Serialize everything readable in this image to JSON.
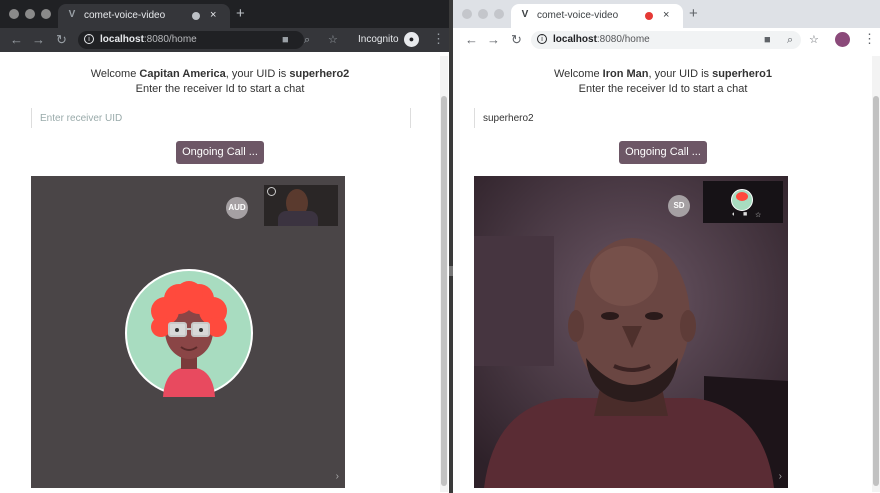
{
  "left_window": {
    "tab_title": "comet-voice-video",
    "url_host": "localhost",
    "url_path": ":8080/home",
    "incognito_label": "Incognito",
    "welcome_prefix": "Welcome ",
    "user_name": "Capitan America",
    "uid_text": ", your UID is ",
    "uid": "superhero2",
    "instructions": "Enter the receiver Id to start a chat",
    "receiver_placeholder": "Enter receiver UID",
    "receiver_value": "",
    "call_button": "Ongoing Call ...",
    "caller_badge": "AUD"
  },
  "right_window": {
    "tab_title": "comet-voice-video",
    "url_host": "localhost",
    "url_path": ":8080/home",
    "welcome_prefix": "Welcome ",
    "user_name": "Iron Man",
    "uid_text": ", your UID is ",
    "uid": "superhero1",
    "instructions": "Enter the receiver Id to start a chat",
    "receiver_placeholder": "",
    "receiver_value": "superhero2",
    "call_button": "Ongoing Call ...",
    "caller_badge": "SD"
  },
  "colors": {
    "call_button": "#6d5766",
    "avatar_bg": "#a8dcc0",
    "avatar_hair": "#ff4a3d"
  }
}
